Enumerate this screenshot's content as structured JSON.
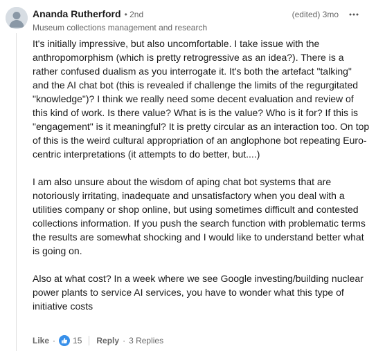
{
  "comment": {
    "author": "Ananda Rutherford",
    "degree": "• 2nd",
    "headline": "Museum collections management and research",
    "meta": "(edited) 3mo",
    "paragraphs": [
      "It's initially impressive, but also uncomfortable. I take issue with the anthropomorphism (which is pretty retrogressive as an idea?). There is a rather confused dualism as you interrogate it. It's both the artefact \"talking\" and the AI chat bot (this is revealed if challenge the limits of the regurgitated \"knowledge\")? I think we really need some decent evaluation and review of this kind of work. Is there value? What is is the value? Who is it for? If this is \"engagement\" is it meaningful? It is pretty circular as an interaction too. On top of this is the weird cultural appropriation of an anglophone bot repeating Euro-centric interpretations (it attempts to do better, but....)",
      "I am also unsure about the wisdom of aping chat bot systems that are notoriously irritating, inadequate and unsatisfactory when you deal with a utilities company or shop online, but using sometimes difficult and contested collections information. If you push the search function with problematic terms the results are somewhat shocking and I would like to understand better what is going on.",
      "Also at what cost? In a week where we see Google investing/building nuclear power plants to service AI services, you have to wonder what this type of initiative costs"
    ],
    "actions": {
      "like_label": "Like",
      "dot": "·",
      "like_count": "15",
      "reply_label": "Reply",
      "replies_text": "3 Replies"
    },
    "colors": {
      "like_badge": "#378fe9",
      "muted_text": "#666666",
      "avatar_bg": "#d7dde3"
    },
    "icons": {
      "avatar": "default-avatar-icon",
      "overflow": "ellipsis-icon",
      "reaction": "thumbs-up-icon"
    }
  }
}
